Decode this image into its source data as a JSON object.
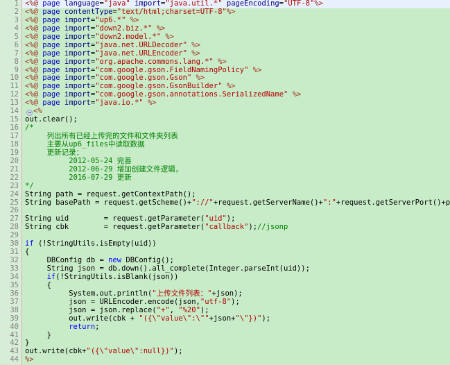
{
  "editor": {
    "name": "jsp-source-editor",
    "language": "JSP",
    "total_lines": 44,
    "current_line": 1,
    "colors": {
      "background": "#c8ebc8",
      "gutter_background": "#d7edd7",
      "current_line_background": "#e8f0fc",
      "gutter_rule": "#e6a8a8",
      "line_number": "#808080",
      "string": "#b00000",
      "comment": "#008000",
      "keyword": "#0000ff",
      "attribute": "#000080",
      "jsp_tag": "#a03020",
      "directive": "#0000c0"
    },
    "fold_markers": [
      14
    ]
  },
  "lines": [
    {
      "n": "1",
      "tokens": [
        {
          "c": "t-tag",
          "t": "<%@"
        },
        {
          "c": "t-plain",
          "t": " "
        },
        {
          "c": "t-kwblue",
          "t": "page"
        },
        {
          "c": "t-plain",
          "t": " "
        },
        {
          "c": "t-attr",
          "t": "language"
        },
        {
          "c": "t-plain",
          "t": "="
        },
        {
          "c": "t-str",
          "t": "\"java\""
        },
        {
          "c": "t-plain",
          "t": " "
        },
        {
          "c": "t-attr",
          "t": "import"
        },
        {
          "c": "t-plain",
          "t": "="
        },
        {
          "c": "t-str",
          "t": "\"java.util.*\""
        },
        {
          "c": "t-plain",
          "t": " "
        },
        {
          "c": "t-attr",
          "t": "pageEncoding"
        },
        {
          "c": "t-plain",
          "t": "="
        },
        {
          "c": "t-str",
          "t": "\"UTF-8\""
        },
        {
          "c": "t-tag",
          "t": "%>"
        }
      ]
    },
    {
      "n": "2",
      "tokens": [
        {
          "c": "t-tag",
          "t": "<%@"
        },
        {
          "c": "t-plain",
          "t": " "
        },
        {
          "c": "t-kwblue",
          "t": "page"
        },
        {
          "c": "t-plain",
          "t": " "
        },
        {
          "c": "t-attr",
          "t": "contentType"
        },
        {
          "c": "t-plain",
          "t": "="
        },
        {
          "c": "t-str",
          "t": "\"text/html;charset=UTF-8\""
        },
        {
          "c": "t-tag",
          "t": "%>"
        }
      ]
    },
    {
      "n": "3",
      "tokens": [
        {
          "c": "t-tag",
          "t": "<%@"
        },
        {
          "c": "t-plain",
          "t": " "
        },
        {
          "c": "t-kwblue",
          "t": "page"
        },
        {
          "c": "t-plain",
          "t": " "
        },
        {
          "c": "t-attr",
          "t": "import"
        },
        {
          "c": "t-plain",
          "t": "="
        },
        {
          "c": "t-str",
          "t": "\"up6.*\""
        },
        {
          "c": "t-plain",
          "t": " "
        },
        {
          "c": "t-tag",
          "t": "%>"
        }
      ]
    },
    {
      "n": "4",
      "tokens": [
        {
          "c": "t-tag",
          "t": "<%@"
        },
        {
          "c": "t-plain",
          "t": " "
        },
        {
          "c": "t-kwblue",
          "t": "page"
        },
        {
          "c": "t-plain",
          "t": " "
        },
        {
          "c": "t-attr",
          "t": "import"
        },
        {
          "c": "t-plain",
          "t": "="
        },
        {
          "c": "t-str",
          "t": "\"down2.biz.*\""
        },
        {
          "c": "t-plain",
          "t": " "
        },
        {
          "c": "t-tag",
          "t": "%>"
        }
      ]
    },
    {
      "n": "5",
      "tokens": [
        {
          "c": "t-tag",
          "t": "<%@"
        },
        {
          "c": "t-plain",
          "t": " "
        },
        {
          "c": "t-kwblue",
          "t": "page"
        },
        {
          "c": "t-plain",
          "t": " "
        },
        {
          "c": "t-attr",
          "t": "import"
        },
        {
          "c": "t-plain",
          "t": "="
        },
        {
          "c": "t-str",
          "t": "\"down2.model.*\""
        },
        {
          "c": "t-plain",
          "t": " "
        },
        {
          "c": "t-tag",
          "t": "%>"
        }
      ]
    },
    {
      "n": "6",
      "tokens": [
        {
          "c": "t-tag",
          "t": "<%@"
        },
        {
          "c": "t-plain",
          "t": " "
        },
        {
          "c": "t-kwblue",
          "t": "page"
        },
        {
          "c": "t-plain",
          "t": " "
        },
        {
          "c": "t-attr",
          "t": "import"
        },
        {
          "c": "t-plain",
          "t": "="
        },
        {
          "c": "t-str",
          "t": "\"java.net.URLDecoder\""
        },
        {
          "c": "t-plain",
          "t": " "
        },
        {
          "c": "t-tag",
          "t": "%>"
        }
      ]
    },
    {
      "n": "7",
      "tokens": [
        {
          "c": "t-tag",
          "t": "<%@"
        },
        {
          "c": "t-plain",
          "t": " "
        },
        {
          "c": "t-kwblue",
          "t": "page"
        },
        {
          "c": "t-plain",
          "t": " "
        },
        {
          "c": "t-attr",
          "t": "import"
        },
        {
          "c": "t-plain",
          "t": "="
        },
        {
          "c": "t-str",
          "t": "\"java.net.URLEncoder\""
        },
        {
          "c": "t-plain",
          "t": " "
        },
        {
          "c": "t-tag",
          "t": "%>"
        }
      ]
    },
    {
      "n": "8",
      "tokens": [
        {
          "c": "t-tag",
          "t": "<%@"
        },
        {
          "c": "t-plain",
          "t": " "
        },
        {
          "c": "t-kwblue",
          "t": "page"
        },
        {
          "c": "t-plain",
          "t": " "
        },
        {
          "c": "t-attr",
          "t": "import"
        },
        {
          "c": "t-plain",
          "t": "="
        },
        {
          "c": "t-str",
          "t": "\"org.apache.commons.lang.*\""
        },
        {
          "c": "t-plain",
          "t": " "
        },
        {
          "c": "t-tag",
          "t": "%>"
        }
      ]
    },
    {
      "n": "9",
      "tokens": [
        {
          "c": "t-tag",
          "t": "<%@"
        },
        {
          "c": "t-plain",
          "t": " "
        },
        {
          "c": "t-kwblue",
          "t": "page"
        },
        {
          "c": "t-plain",
          "t": " "
        },
        {
          "c": "t-attr",
          "t": "import"
        },
        {
          "c": "t-plain",
          "t": "="
        },
        {
          "c": "t-str",
          "t": "\"com.google.gson.FieldNamingPolicy\""
        },
        {
          "c": "t-plain",
          "t": " "
        },
        {
          "c": "t-tag",
          "t": "%>"
        }
      ]
    },
    {
      "n": "10",
      "tokens": [
        {
          "c": "t-tag",
          "t": "<%@"
        },
        {
          "c": "t-plain",
          "t": " "
        },
        {
          "c": "t-kwblue",
          "t": "page"
        },
        {
          "c": "t-plain",
          "t": " "
        },
        {
          "c": "t-attr",
          "t": "import"
        },
        {
          "c": "t-plain",
          "t": "="
        },
        {
          "c": "t-str",
          "t": "\"com.google.gson.Gson\""
        },
        {
          "c": "t-plain",
          "t": " "
        },
        {
          "c": "t-tag",
          "t": "%>"
        }
      ]
    },
    {
      "n": "11",
      "tokens": [
        {
          "c": "t-tag",
          "t": "<%@"
        },
        {
          "c": "t-plain",
          "t": " "
        },
        {
          "c": "t-kwblue",
          "t": "page"
        },
        {
          "c": "t-plain",
          "t": " "
        },
        {
          "c": "t-attr",
          "t": "import"
        },
        {
          "c": "t-plain",
          "t": "="
        },
        {
          "c": "t-str",
          "t": "\"com.google.gson.GsonBuilder\""
        },
        {
          "c": "t-plain",
          "t": " "
        },
        {
          "c": "t-tag",
          "t": "%>"
        }
      ]
    },
    {
      "n": "12",
      "tokens": [
        {
          "c": "t-tag",
          "t": "<%@"
        },
        {
          "c": "t-plain",
          "t": " "
        },
        {
          "c": "t-kwblue",
          "t": "page"
        },
        {
          "c": "t-plain",
          "t": " "
        },
        {
          "c": "t-attr",
          "t": "import"
        },
        {
          "c": "t-plain",
          "t": "="
        },
        {
          "c": "t-str",
          "t": "\"com.google.gson.annotations.SerializedName\""
        },
        {
          "c": "t-plain",
          "t": " "
        },
        {
          "c": "t-tag",
          "t": "%>"
        }
      ]
    },
    {
      "n": "13",
      "tokens": [
        {
          "c": "t-tag",
          "t": "<%@"
        },
        {
          "c": "t-plain",
          "t": " "
        },
        {
          "c": "t-kwblue",
          "t": "page"
        },
        {
          "c": "t-plain",
          "t": " "
        },
        {
          "c": "t-attr",
          "t": "import"
        },
        {
          "c": "t-plain",
          "t": "="
        },
        {
          "c": "t-str",
          "t": "\"java.io.*\""
        },
        {
          "c": "t-plain",
          "t": " "
        },
        {
          "c": "t-tag",
          "t": "%>"
        }
      ]
    },
    {
      "n": "14",
      "fold": true,
      "tokens": [
        {
          "c": "t-tag",
          "t": "<%"
        }
      ]
    },
    {
      "n": "15",
      "tokens": [
        {
          "c": "t-plain",
          "t": "out.clear();"
        }
      ]
    },
    {
      "n": "16",
      "tokens": [
        {
          "c": "t-com",
          "t": "/*"
        }
      ]
    },
    {
      "n": "17",
      "tokens": [
        {
          "c": "t-com",
          "t": "     列出所有已经上传完的文件和文件夹列表"
        }
      ]
    },
    {
      "n": "18",
      "tokens": [
        {
          "c": "t-com",
          "t": "     主要从up6_files中读取数据"
        }
      ]
    },
    {
      "n": "19",
      "tokens": [
        {
          "c": "t-com",
          "t": "     更新记录："
        }
      ]
    },
    {
      "n": "20",
      "tokens": [
        {
          "c": "t-com",
          "t": "          2012-05-24 完善"
        }
      ]
    },
    {
      "n": "21",
      "tokens": [
        {
          "c": "t-com",
          "t": "          2012-06-29 增加创建文件逻辑，"
        }
      ]
    },
    {
      "n": "22",
      "tokens": [
        {
          "c": "t-com",
          "t": "          2016-07-29 更新"
        }
      ]
    },
    {
      "n": "23",
      "tokens": [
        {
          "c": "t-com",
          "t": "*/"
        }
      ]
    },
    {
      "n": "24",
      "tokens": [
        {
          "c": "t-plain",
          "t": "String path = request.getContextPath();"
        }
      ]
    },
    {
      "n": "25",
      "tokens": [
        {
          "c": "t-plain",
          "t": "String basePath = request.getScheme()+"
        },
        {
          "c": "t-str",
          "t": "\"://\""
        },
        {
          "c": "t-plain",
          "t": "+request.getServerName()+"
        },
        {
          "c": "t-str",
          "t": "\":\""
        },
        {
          "c": "t-plain",
          "t": "+request.getServerPort()+path+"
        },
        {
          "c": "t-str",
          "t": "\"/\""
        },
        {
          "c": "t-plain",
          "t": ";"
        }
      ]
    },
    {
      "n": "26",
      "tokens": []
    },
    {
      "n": "27",
      "tokens": [
        {
          "c": "t-plain",
          "t": "String uid        = request.getParameter("
        },
        {
          "c": "t-str",
          "t": "\"uid\""
        },
        {
          "c": "t-plain",
          "t": ");"
        }
      ]
    },
    {
      "n": "28",
      "tokens": [
        {
          "c": "t-plain",
          "t": "String cbk        = request.getParameter("
        },
        {
          "c": "t-str",
          "t": "\"callback\""
        },
        {
          "c": "t-plain",
          "t": ");"
        },
        {
          "c": "t-com",
          "t": "//jsonp"
        }
      ]
    },
    {
      "n": "29",
      "tokens": []
    },
    {
      "n": "30",
      "tokens": [
        {
          "c": "t-kw",
          "t": "if"
        },
        {
          "c": "t-plain",
          "t": " (!StringUtils.isEmpty(uid))"
        }
      ]
    },
    {
      "n": "31",
      "tokens": [
        {
          "c": "t-plain",
          "t": "{"
        }
      ]
    },
    {
      "n": "32",
      "tokens": [
        {
          "c": "t-plain",
          "t": "     DBConfig db = "
        },
        {
          "c": "t-kw",
          "t": "new"
        },
        {
          "c": "t-plain",
          "t": " DBConfig();"
        }
      ]
    },
    {
      "n": "33",
      "tokens": [
        {
          "c": "t-plain",
          "t": "     String json = db.down().all_complete(Integer.parseInt(uid));"
        }
      ]
    },
    {
      "n": "34",
      "tokens": [
        {
          "c": "t-plain",
          "t": "     "
        },
        {
          "c": "t-kw",
          "t": "if"
        },
        {
          "c": "t-plain",
          "t": "(!StringUtils.isBlank(json))"
        }
      ]
    },
    {
      "n": "35",
      "tokens": [
        {
          "c": "t-plain",
          "t": "     {"
        }
      ]
    },
    {
      "n": "36",
      "tokens": [
        {
          "c": "t-plain",
          "t": "          System.out.println("
        },
        {
          "c": "t-str",
          "t": "\"上传文件列表：\""
        },
        {
          "c": "t-plain",
          "t": "+json);"
        }
      ]
    },
    {
      "n": "37",
      "tokens": [
        {
          "c": "t-plain",
          "t": "          json = URLEncoder.encode(json,"
        },
        {
          "c": "t-str",
          "t": "\"utf-8\""
        },
        {
          "c": "t-plain",
          "t": ");"
        }
      ]
    },
    {
      "n": "38",
      "tokens": [
        {
          "c": "t-plain",
          "t": "          json = json.replace("
        },
        {
          "c": "t-str",
          "t": "\"+\""
        },
        {
          "c": "t-plain",
          "t": ", "
        },
        {
          "c": "t-str",
          "t": "\"%20\""
        },
        {
          "c": "t-plain",
          "t": ");"
        }
      ]
    },
    {
      "n": "39",
      "tokens": [
        {
          "c": "t-plain",
          "t": "          out.write(cbk + "
        },
        {
          "c": "t-str",
          "t": "\"({\\\"value\\\":\\\"\""
        },
        {
          "c": "t-plain",
          "t": "+json+"
        },
        {
          "c": "t-str",
          "t": "\"\\\"})\""
        },
        {
          "c": "t-plain",
          "t": ");"
        }
      ]
    },
    {
      "n": "40",
      "tokens": [
        {
          "c": "t-plain",
          "t": "          "
        },
        {
          "c": "t-kw",
          "t": "return"
        },
        {
          "c": "t-plain",
          "t": ";"
        }
      ]
    },
    {
      "n": "41",
      "tokens": [
        {
          "c": "t-plain",
          "t": "     }"
        }
      ]
    },
    {
      "n": "42",
      "tokens": [
        {
          "c": "t-plain",
          "t": "}"
        }
      ]
    },
    {
      "n": "43",
      "tokens": [
        {
          "c": "t-plain",
          "t": "out.write(cbk+"
        },
        {
          "c": "t-str",
          "t": "\"({\\\"value\\\":null})\""
        },
        {
          "c": "t-plain",
          "t": ");"
        }
      ]
    },
    {
      "n": "44",
      "tokens": [
        {
          "c": "t-tag",
          "t": "%>"
        }
      ]
    }
  ]
}
